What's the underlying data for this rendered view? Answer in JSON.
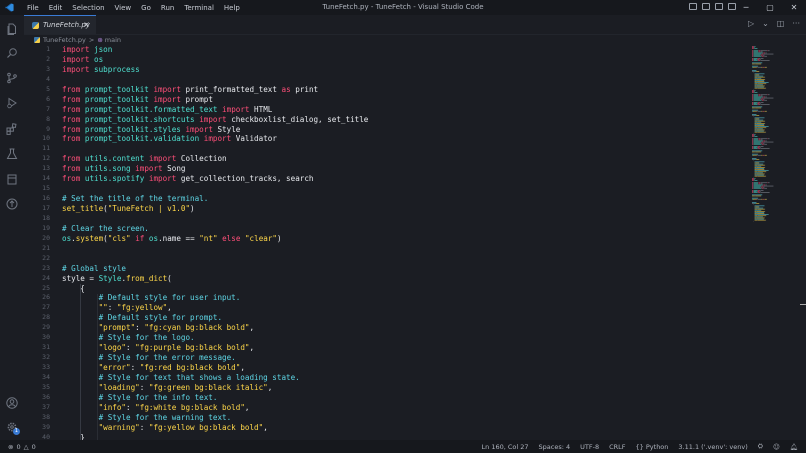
{
  "menu": [
    "File",
    "Edit",
    "Selection",
    "View",
    "Go",
    "Run",
    "Terminal",
    "Help"
  ],
  "window_title": "TuneFetch.py - TuneFetch - Visual Studio Code",
  "tab": {
    "label": "TuneFetch.py",
    "close": "×"
  },
  "breadcrumb": {
    "file": "TuneFetch.py",
    "symbol": "main",
    "separator": ">"
  },
  "window_controls": [
    "─",
    "▢",
    "✕"
  ],
  "editor_actions": [
    "▷",
    "⌄",
    "◫",
    "···"
  ],
  "colors": {
    "keyword": "#ff4f79",
    "module": "#4fe0d0",
    "function": "#ffd84a",
    "string": "#ffd84a",
    "comment": "#5fd7e6",
    "background": "#1b1d23"
  },
  "line_numbers": [
    "1",
    "2",
    "3",
    "4",
    "5",
    "6",
    "7",
    "8",
    "9",
    "10",
    "11",
    "12",
    "13",
    "14",
    "15",
    "16",
    "17",
    "18",
    "19",
    "20",
    "21",
    "22",
    "23",
    "24",
    "25",
    "26",
    "27",
    "28",
    "29",
    "30",
    "31",
    "32",
    "33",
    "34",
    "35",
    "36",
    "37",
    "38",
    "39",
    "40"
  ],
  "code_lines": [
    [
      [
        "kw",
        "import"
      ],
      [
        "pl",
        " "
      ],
      [
        "mod",
        "json"
      ]
    ],
    [
      [
        "kw",
        "import"
      ],
      [
        "pl",
        " "
      ],
      [
        "mod",
        "os"
      ]
    ],
    [
      [
        "kw",
        "import"
      ],
      [
        "pl",
        " "
      ],
      [
        "mod",
        "subprocess"
      ]
    ],
    [],
    [
      [
        "kw",
        "from"
      ],
      [
        "pl",
        " "
      ],
      [
        "mod",
        "prompt_toolkit"
      ],
      [
        "pl",
        " "
      ],
      [
        "kw",
        "import"
      ],
      [
        "pl",
        " print_formatted_text "
      ],
      [
        "kw",
        "as"
      ],
      [
        "pl",
        " print"
      ]
    ],
    [
      [
        "kw",
        "from"
      ],
      [
        "pl",
        " "
      ],
      [
        "mod",
        "prompt_toolkit"
      ],
      [
        "pl",
        " "
      ],
      [
        "kw",
        "import"
      ],
      [
        "pl",
        " prompt"
      ]
    ],
    [
      [
        "kw",
        "from"
      ],
      [
        "pl",
        " "
      ],
      [
        "mod",
        "prompt_toolkit.formatted_text"
      ],
      [
        "pl",
        " "
      ],
      [
        "kw",
        "import"
      ],
      [
        "pl",
        " HTML"
      ]
    ],
    [
      [
        "kw",
        "from"
      ],
      [
        "pl",
        " "
      ],
      [
        "mod",
        "prompt_toolkit.shortcuts"
      ],
      [
        "pl",
        " "
      ],
      [
        "kw",
        "import"
      ],
      [
        "pl",
        " checkboxlist_dialog, set_title"
      ]
    ],
    [
      [
        "kw",
        "from"
      ],
      [
        "pl",
        " "
      ],
      [
        "mod",
        "prompt_toolkit.styles"
      ],
      [
        "pl",
        " "
      ],
      [
        "kw",
        "import"
      ],
      [
        "pl",
        " Style"
      ]
    ],
    [
      [
        "kw",
        "from"
      ],
      [
        "pl",
        " "
      ],
      [
        "mod",
        "prompt_toolkit.validation"
      ],
      [
        "pl",
        " "
      ],
      [
        "kw",
        "import"
      ],
      [
        "pl",
        " Validator"
      ]
    ],
    [],
    [
      [
        "kw",
        "from"
      ],
      [
        "pl",
        " "
      ],
      [
        "mod",
        "utils.content"
      ],
      [
        "pl",
        " "
      ],
      [
        "kw",
        "import"
      ],
      [
        "pl",
        " Collection"
      ]
    ],
    [
      [
        "kw",
        "from"
      ],
      [
        "pl",
        " "
      ],
      [
        "mod",
        "utils.song"
      ],
      [
        "pl",
        " "
      ],
      [
        "kw",
        "import"
      ],
      [
        "pl",
        " Song"
      ]
    ],
    [
      [
        "kw",
        "from"
      ],
      [
        "pl",
        " "
      ],
      [
        "mod",
        "utils.spotify"
      ],
      [
        "pl",
        " "
      ],
      [
        "kw",
        "import"
      ],
      [
        "pl",
        " get_collection_tracks, search"
      ]
    ],
    [],
    [
      [
        "cm",
        "# Set the title of the terminal."
      ]
    ],
    [
      [
        "fn",
        "set_title"
      ],
      [
        "pl",
        "("
      ],
      [
        "str",
        "\"TuneFetch | v1.0\""
      ],
      [
        "pl",
        ")"
      ]
    ],
    [],
    [
      [
        "cm",
        "# Clear the screen."
      ]
    ],
    [
      [
        "mod",
        "os"
      ],
      [
        "pl",
        "."
      ],
      [
        "fn",
        "system"
      ],
      [
        "pl",
        "("
      ],
      [
        "str",
        "\"cls\""
      ],
      [
        "pl",
        " "
      ],
      [
        "kw",
        "if"
      ],
      [
        "pl",
        " "
      ],
      [
        "mod",
        "os"
      ],
      [
        "pl",
        ".name == "
      ],
      [
        "str",
        "\"nt\""
      ],
      [
        "pl",
        " "
      ],
      [
        "kw",
        "else"
      ],
      [
        "pl",
        " "
      ],
      [
        "str",
        "\"clear\""
      ],
      [
        "pl",
        ")"
      ]
    ],
    [],
    [],
    [
      [
        "cm",
        "# Global style"
      ]
    ],
    [
      [
        "pl",
        "style = "
      ],
      [
        "mod",
        "Style"
      ],
      [
        "pl",
        "."
      ],
      [
        "fn",
        "from_dict"
      ],
      [
        "pl",
        "("
      ]
    ],
    [
      [
        "pl",
        "    {"
      ]
    ],
    [
      [
        "cm",
        "        # Default style for user input."
      ]
    ],
    [
      [
        "str",
        "        \"\""
      ],
      [
        "pl",
        ": "
      ],
      [
        "str",
        "\"fg:yellow\""
      ],
      [
        "pl",
        ","
      ]
    ],
    [
      [
        "cm",
        "        # Default style for prompt."
      ]
    ],
    [
      [
        "str",
        "        \"prompt\""
      ],
      [
        "pl",
        ": "
      ],
      [
        "str",
        "\"fg:cyan bg:black bold\""
      ],
      [
        "pl",
        ","
      ]
    ],
    [
      [
        "cm",
        "        # Style for the logo."
      ]
    ],
    [
      [
        "str",
        "        \"logo\""
      ],
      [
        "pl",
        ": "
      ],
      [
        "str",
        "\"fg:purple bg:black bold\""
      ],
      [
        "pl",
        ","
      ]
    ],
    [
      [
        "cm",
        "        # Style for the error message."
      ]
    ],
    [
      [
        "str",
        "        \"error\""
      ],
      [
        "pl",
        ": "
      ],
      [
        "str",
        "\"fg:red bg:black bold\""
      ],
      [
        "pl",
        ","
      ]
    ],
    [
      [
        "cm",
        "        # Style for text that shows a loading state."
      ]
    ],
    [
      [
        "str",
        "        \"loading\""
      ],
      [
        "pl",
        ": "
      ],
      [
        "str",
        "\"fg:green bg:black italic\""
      ],
      [
        "pl",
        ","
      ]
    ],
    [
      [
        "cm",
        "        # Style for the info text."
      ]
    ],
    [
      [
        "str",
        "        \"info\""
      ],
      [
        "pl",
        ": "
      ],
      [
        "str",
        "\"fg:white bg:black bold\""
      ],
      [
        "pl",
        ","
      ]
    ],
    [
      [
        "cm",
        "        # Style for the warning text."
      ]
    ],
    [
      [
        "str",
        "        \"warning\""
      ],
      [
        "pl",
        ": "
      ],
      [
        "str",
        "\"fg:yellow bg:black bold\""
      ],
      [
        "pl",
        ","
      ]
    ],
    [
      [
        "pl",
        "    }"
      ]
    ]
  ],
  "status": {
    "errors": "0",
    "warnings": "0",
    "position": "Ln 160, Col 27",
    "spaces": "Spaces: 4",
    "encoding": "UTF-8",
    "eol": "CRLF",
    "language": "Python",
    "interpreter": "3.11.1 ('.venv': venv)",
    "accounts_badge": "1"
  },
  "icons": {
    "activity": [
      "files-icon",
      "search-icon",
      "source-control-icon",
      "run-debug-icon",
      "extensions-icon",
      "testing-icon",
      "docker-icon",
      "remote-icon"
    ],
    "bottom": [
      "account-icon",
      "manage-gear-icon"
    ]
  }
}
